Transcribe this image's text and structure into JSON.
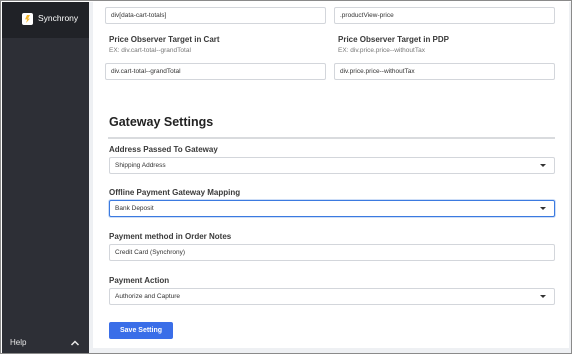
{
  "sidebar": {
    "brand": "Synchrony",
    "help_label": "Help"
  },
  "price_observer": {
    "top_left_value": "div[data-cart-totals]",
    "top_right_value": ".productView-price",
    "cart_label": "Price Observer Target in Cart",
    "cart_hint": "EX: div.cart-total--grandTotal",
    "cart_value": "div.cart-total--grandTotal",
    "pdp_label": "Price Observer Target in PDP",
    "pdp_hint": "EX: div.price.price--withoutTax",
    "pdp_value": "div.price.price--withoutTax"
  },
  "gateway": {
    "title": "Gateway Settings",
    "address_label": "Address Passed To Gateway",
    "address_value": "Shipping Address",
    "offline_label": "Offline Payment Gateway Mapping",
    "offline_value": "Bank Deposit",
    "notes_label": "Payment method in Order Notes",
    "notes_value": "Credit Card (Synchrony)",
    "action_label": "Payment Action",
    "action_value": "Authorize and Capture",
    "save_label": "Save Setting"
  },
  "colors": {
    "sidebar_bg": "#2d2f36",
    "brand_bg": "#202227",
    "accent": "#3a6ee8",
    "logo_accent": "#f5b82e"
  }
}
